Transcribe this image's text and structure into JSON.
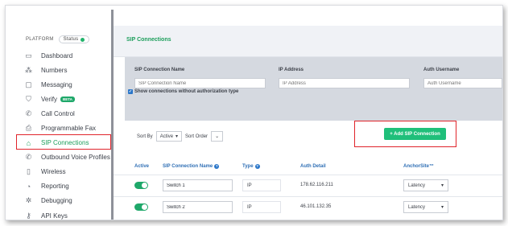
{
  "sidebar": {
    "section_label": "PLATFORM",
    "status_label": "Status",
    "items": [
      {
        "label": "Dashboard",
        "icon": "dashboard-icon",
        "glyph": "▭"
      },
      {
        "label": "Numbers",
        "icon": "numbers-icon",
        "glyph": "⁂"
      },
      {
        "label": "Messaging",
        "icon": "messaging-icon",
        "glyph": "▢"
      },
      {
        "label": "Verify",
        "icon": "shield-check-icon",
        "glyph": "⛉",
        "badge": "BETA"
      },
      {
        "label": "Call Control",
        "icon": "phone-icon",
        "glyph": "✆"
      },
      {
        "label": "Programmable Fax",
        "icon": "fax-icon",
        "glyph": "⎙"
      },
      {
        "label": "SIP Connections",
        "icon": "sip-connections-icon",
        "glyph": "⌂",
        "active": true
      },
      {
        "label": "Outbound Voice Profiles",
        "icon": "outbound-call-icon",
        "glyph": "✆"
      },
      {
        "label": "Wireless",
        "icon": "wireless-icon",
        "glyph": "▯"
      },
      {
        "label": "Reporting",
        "icon": "reporting-icon",
        "glyph": "◔"
      },
      {
        "label": "Debugging",
        "icon": "bug-icon",
        "glyph": "✲"
      },
      {
        "label": "API Keys",
        "icon": "key-icon",
        "glyph": "⚷"
      }
    ]
  },
  "page": {
    "title": "SIP Connections"
  },
  "filters": {
    "name_label": "SIP Connection Name",
    "name_placeholder": "SIP Connection Name",
    "ip_label": "IP Address",
    "ip_placeholder": "IP Address",
    "auth_label": "Auth Username",
    "auth_placeholder": "Auth Username",
    "checkbox_label": "Show connections without authorization type"
  },
  "sort": {
    "sort_by_label": "Sort By",
    "sort_by_value": "Active",
    "sort_order_label": "Sort Order"
  },
  "add_button_label": "+ Add SIP Connection",
  "table": {
    "headers": {
      "active": "Active",
      "name": "SIP Connection Name",
      "type": "Type",
      "auth": "Auth Detail",
      "anchor": "AnchorSite™"
    },
    "rows": [
      {
        "name": "Switch 1",
        "type": "IP",
        "auth": "178.62.116.211",
        "anchor": "Latency",
        "active": true
      },
      {
        "name": "Switch 2",
        "type": "IP",
        "auth": "46.101.132.35",
        "anchor": "Latency",
        "active": true
      }
    ]
  },
  "colors": {
    "accent": "#1fbf7a",
    "active_nav": "#1c9e5b",
    "highlight": "#e0242b",
    "header_link": "#2f6fb5"
  }
}
